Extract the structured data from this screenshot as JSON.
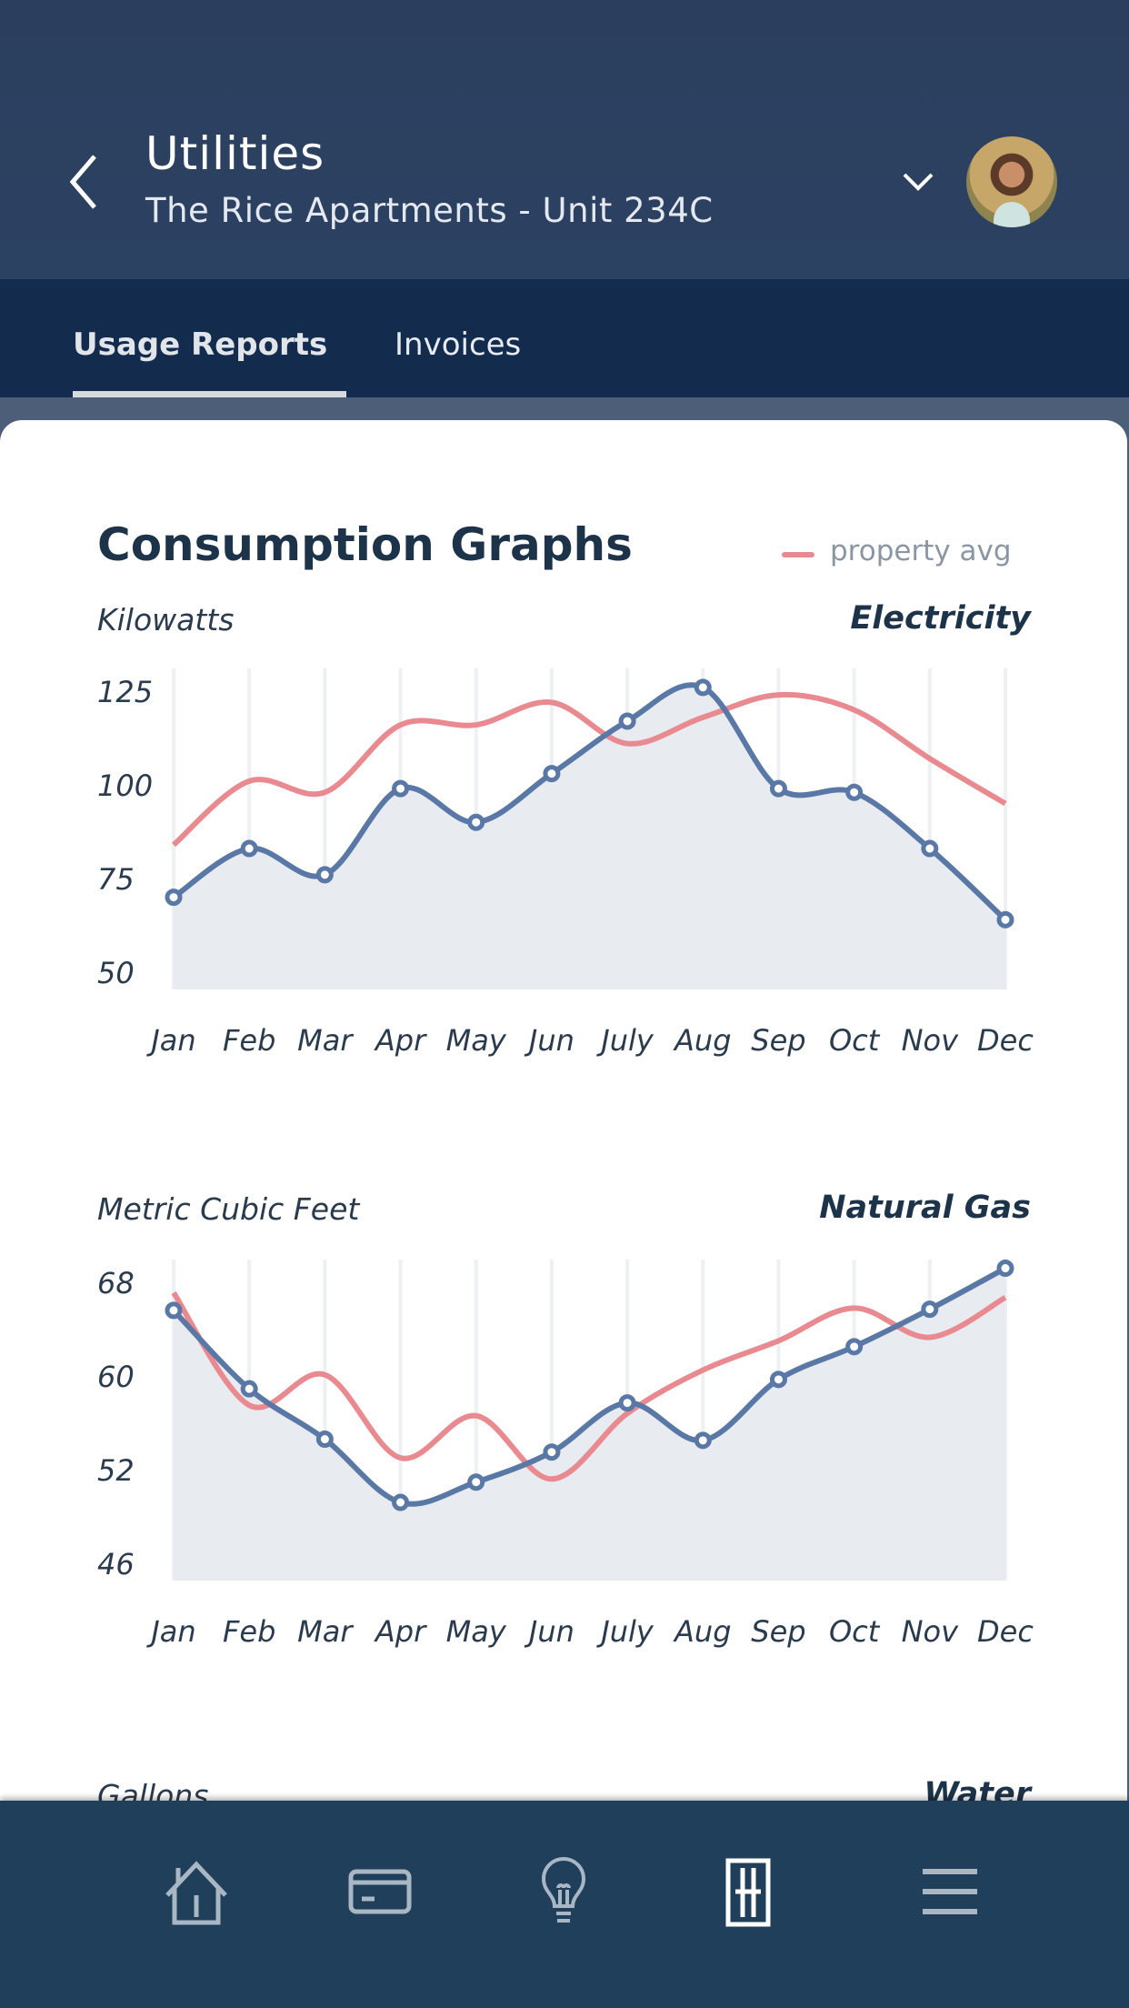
{
  "header": {
    "title": "Utilities",
    "subtitle": "The Rice Apartments - Unit 234C"
  },
  "tabs": [
    {
      "label": "Usage Reports",
      "active": true
    },
    {
      "label": "Invoices",
      "active": false
    }
  ],
  "section_title": "Consumption Graphs",
  "legend": {
    "label": "property avg",
    "color": "#e88a90"
  },
  "colors": {
    "unit_series": "#5a78a6",
    "property_avg": "#e88a90",
    "fill": "#e8ebf0"
  },
  "chart_data": [
    {
      "type": "line",
      "title": "Electricity",
      "ylabel": "Kilowatts",
      "categories": [
        "Jan",
        "Feb",
        "Mar",
        "Apr",
        "May",
        "Jun",
        "July",
        "Aug",
        "Sep",
        "Oct",
        "Nov",
        "Dec"
      ],
      "yticks": [
        50,
        75,
        100,
        125
      ],
      "series": [
        {
          "values": [
            70,
            83,
            76,
            99,
            90,
            103,
            117,
            126,
            99,
            98,
            83,
            64
          ]
        },
        {
          "name": "property avg",
          "values": [
            84,
            101,
            98,
            116,
            116,
            122,
            111,
            118,
            124,
            120,
            107,
            95
          ]
        }
      ]
    },
    {
      "type": "line",
      "title": "Natural Gas",
      "ylabel": "Metric Cubic Feet",
      "categories": [
        "Jan",
        "Feb",
        "Mar",
        "Apr",
        "May",
        "Jun",
        "July",
        "Aug",
        "Sep",
        "Oct",
        "Nov",
        "Dec"
      ],
      "yticks": [
        46,
        52,
        60,
        68
      ],
      "series": [
        {
          "values": [
            65.6,
            58.9,
            54.6,
            49.9,
            51.2,
            53.5,
            57.7,
            54.5,
            59.7,
            62.5,
            65.7,
            69.2
          ]
        },
        {
          "name": "property avg",
          "values": [
            67.1,
            57.5,
            60.1,
            53.0,
            56.6,
            51.4,
            56.8,
            60.5,
            63.0,
            65.8,
            63.3,
            66.7
          ]
        }
      ]
    },
    {
      "type": "line",
      "title": "Water",
      "ylabel": "Gallons"
    }
  ],
  "nav": [
    {
      "icon": "home-icon"
    },
    {
      "icon": "credit-card-icon"
    },
    {
      "icon": "lightbulb-icon"
    },
    {
      "icon": "building-icon",
      "active": true
    },
    {
      "icon": "menu-icon"
    }
  ]
}
